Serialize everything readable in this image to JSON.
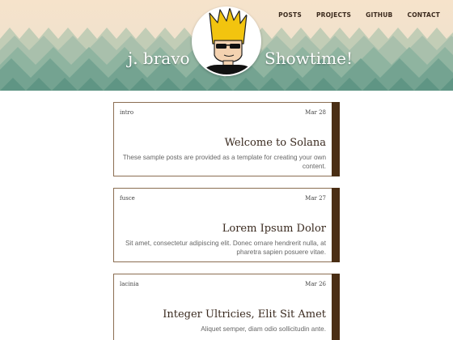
{
  "nav": {
    "items": [
      "POSTS",
      "PROJECTS",
      "GITHUB",
      "CONTACT"
    ]
  },
  "brand": {
    "left": "j. bravo",
    "right": "Showtime!",
    "avatar_icon": "cartoon-avatar-icon"
  },
  "colors": {
    "header_bg": "#f1e2cc",
    "mountain_light": "#a9c0ac",
    "mountain_mid": "#7fa996",
    "mountain_dark": "#5e9482",
    "accent_bar": "#4a2e14",
    "card_border": "#8b6e52"
  },
  "posts": [
    {
      "tag": "intro",
      "date": "Mar 28",
      "title": "Welcome to Solana",
      "excerpt": "These sample posts are provided as a template for creating your own content."
    },
    {
      "tag": "fusce",
      "date": "Mar 27",
      "title": "Lorem Ipsum Dolor",
      "excerpt": "Sit amet, consectetur adipiscing elit. Donec ornare hendrerit nulla, at pharetra sapien posuere vitae."
    },
    {
      "tag": "lacinia",
      "date": "Mar 26",
      "title": "Integer Ultricies, Elit Sit Amet",
      "excerpt": "Aliquet semper, diam odio sollicitudin ante."
    }
  ]
}
